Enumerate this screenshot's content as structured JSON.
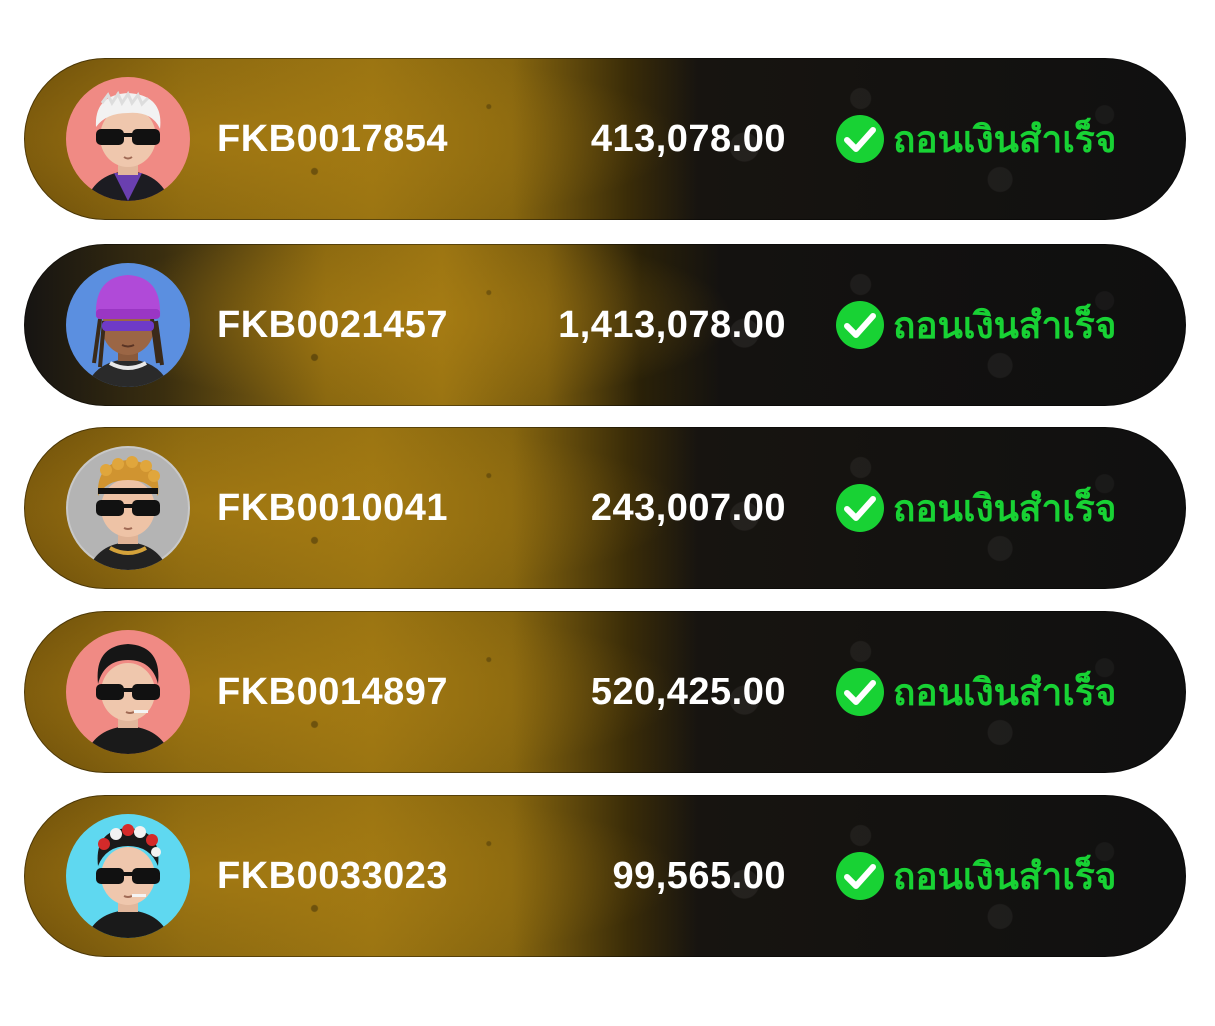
{
  "withdrawals": [
    {
      "user_id": "FKB0017854",
      "amount": "413,078.00",
      "status": "ถอนเงินสำเร็จ",
      "avatar_bg": "#f08a84",
      "avatar_icon": "avatar-white-hair-sunglasses"
    },
    {
      "user_id": "FKB0021457",
      "amount": "1,413,078.00",
      "status": "ถอนเงินสำเร็จ",
      "avatar_bg": "#5b8fe0",
      "avatar_icon": "avatar-purple-beanie"
    },
    {
      "user_id": "FKB0010041",
      "amount": "243,007.00",
      "status": "ถอนเงินสำเร็จ",
      "avatar_bg": "#c8c8c8",
      "avatar_icon": "avatar-curly-gold-hair-sunglasses"
    },
    {
      "user_id": "FKB0014897",
      "amount": "520,425.00",
      "status": "ถอนเงินสำเร็จ",
      "avatar_bg": "#f08a84",
      "avatar_icon": "avatar-black-hair-sunglasses"
    },
    {
      "user_id": "FKB0033023",
      "amount": "99,565.00",
      "status": "ถอนเงินสำเร็จ",
      "avatar_bg": "#5fd8f0",
      "avatar_icon": "avatar-red-white-hair-sunglasses"
    }
  ],
  "colors": {
    "status_green": "#18d234",
    "text_white": "#ffffff"
  }
}
